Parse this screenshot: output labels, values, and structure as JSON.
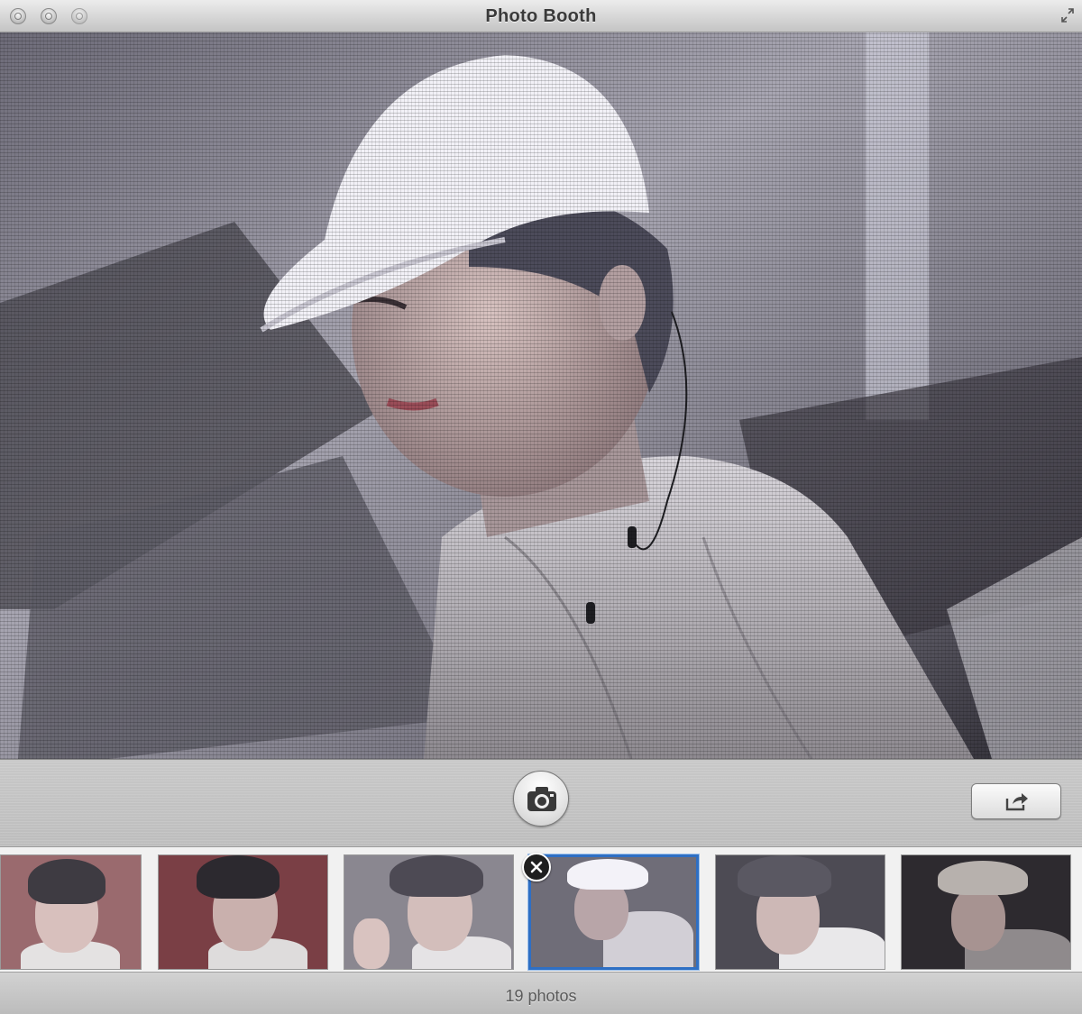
{
  "window": {
    "title": "Photo Booth"
  },
  "toolbar": {
    "capture_icon": "camera-icon",
    "share_icon": "share-arrow-icon"
  },
  "filmstrip": {
    "thumbnails": [
      {
        "description_icon": "photo-thumbnail",
        "selected": false
      },
      {
        "description_icon": "photo-thumbnail",
        "selected": false
      },
      {
        "description_icon": "photo-thumbnail",
        "selected": false
      },
      {
        "description_icon": "photo-thumbnail",
        "selected": true
      },
      {
        "description_icon": "photo-thumbnail",
        "selected": false
      },
      {
        "description_icon": "photo-thumbnail",
        "selected": false
      }
    ],
    "delete_icon": "close-icon"
  },
  "status": {
    "count_label": "19 photos"
  },
  "colors": {
    "selection": "#2e6fc4",
    "chrome": "#d6d6d6"
  }
}
